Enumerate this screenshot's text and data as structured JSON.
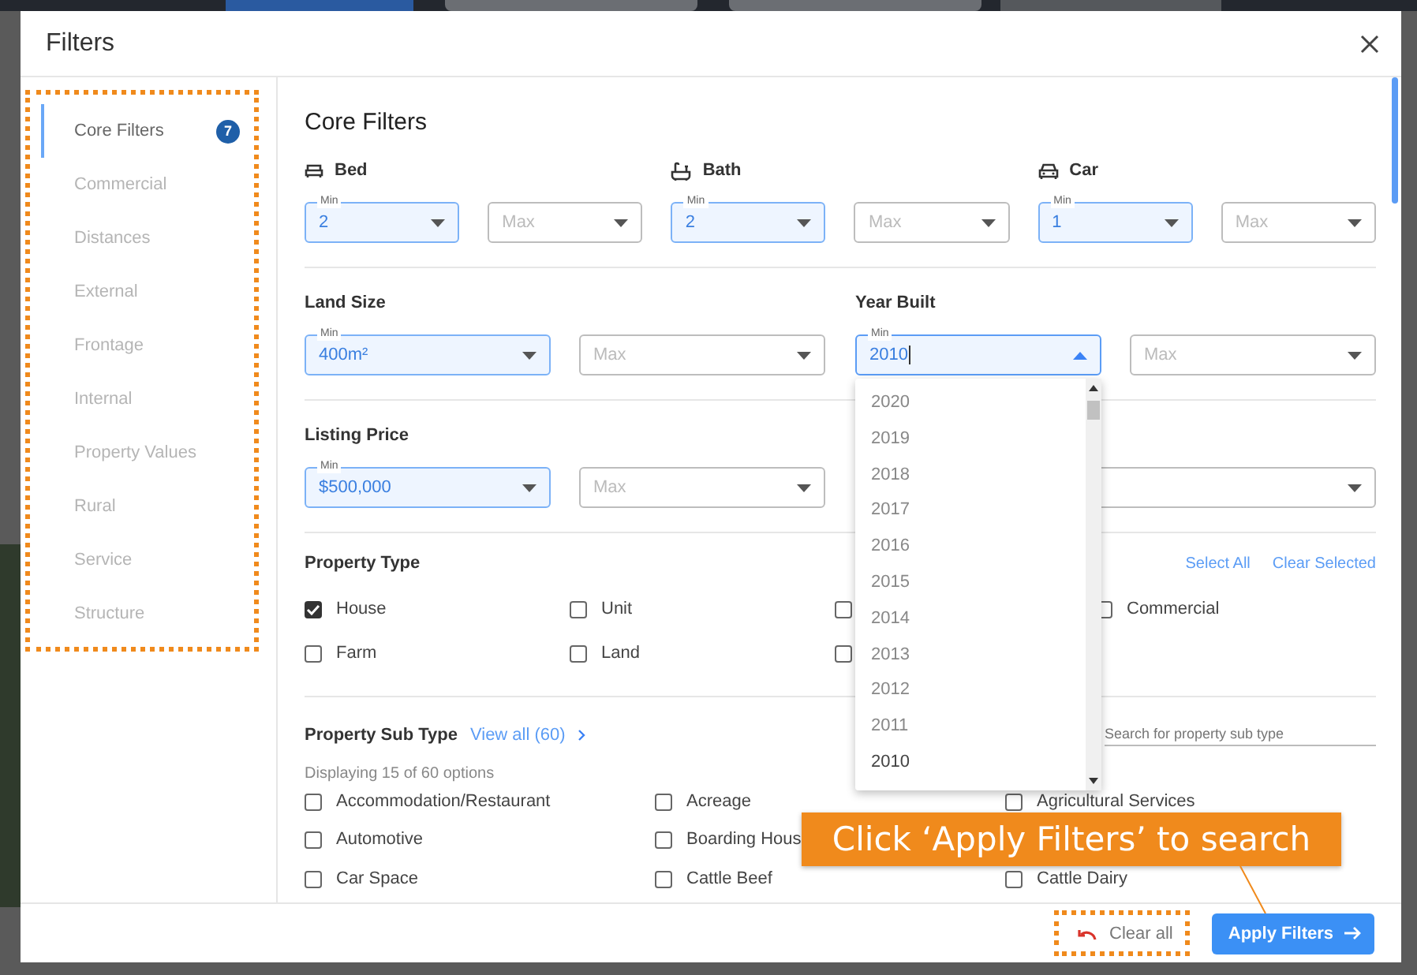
{
  "dialog": {
    "title": "Filters"
  },
  "sidebar": {
    "items": [
      {
        "label": "Core Filters",
        "selected": true,
        "badge": "7"
      },
      {
        "label": "Commercial",
        "selected": false
      },
      {
        "label": "Distances",
        "selected": false
      },
      {
        "label": "External",
        "selected": false
      },
      {
        "label": "Frontage",
        "selected": false
      },
      {
        "label": "Internal",
        "selected": false
      },
      {
        "label": "Property Values",
        "selected": false
      },
      {
        "label": "Rural",
        "selected": false
      },
      {
        "label": "Service",
        "selected": false
      },
      {
        "label": "Structure",
        "selected": false
      }
    ]
  },
  "section_title": "Core Filters",
  "field_rows": [
    {
      "groups": [
        {
          "label": "Bed",
          "kind": "bed",
          "selects": [
            {
              "label": "Min",
              "value": "2"
            },
            {
              "placeholder": "Max"
            }
          ]
        },
        {
          "label": "Bath",
          "kind": "bath",
          "selects": [
            {
              "label": "Min",
              "value": "2"
            },
            {
              "placeholder": "Max"
            }
          ]
        },
        {
          "label": "Car",
          "kind": "car",
          "selects": [
            {
              "label": "Min",
              "value": "1"
            },
            {
              "placeholder": "Max"
            }
          ]
        }
      ]
    },
    {
      "groups": [
        {
          "label": "Land Size",
          "kind": "range",
          "selects": [
            {
              "label": "Min",
              "value": "400m²"
            },
            {
              "placeholder": "Max"
            }
          ]
        },
        {
          "label": "Year Built",
          "kind": "range",
          "selects": [
            {
              "label": "Min",
              "value": "2010",
              "open": true,
              "options": [
                {
                  "label": "2020",
                  "selected": false
                },
                {
                  "label": "2019",
                  "selected": false
                },
                {
                  "label": "2018",
                  "selected": false
                },
                {
                  "label": "2017",
                  "selected": false
                },
                {
                  "label": "2016",
                  "selected": false
                },
                {
                  "label": "2015",
                  "selected": false
                },
                {
                  "label": "2014",
                  "selected": false
                },
                {
                  "label": "2013",
                  "selected": false
                },
                {
                  "label": "2012",
                  "selected": false
                },
                {
                  "label": "2011",
                  "selected": false
                },
                {
                  "label": "2010",
                  "selected": true
                }
              ]
            },
            {
              "placeholder": "Max"
            }
          ]
        }
      ]
    },
    {
      "groups": [
        {
          "label": "Listing Price",
          "kind": "range",
          "selects": [
            {
              "label": "Min",
              "value": "$500,000"
            },
            {
              "placeholder": "Max"
            }
          ]
        },
        {
          "kind": "select"
        }
      ]
    }
  ],
  "property_type": {
    "title": "Property Type",
    "actions": [
      "Select All",
      "Clear Selected"
    ],
    "options": [
      {
        "label": "House",
        "checked": true
      },
      {
        "label": "Unit",
        "checked": false
      },
      {
        "checked": false
      },
      {
        "label": "Commercial",
        "checked": false
      },
      {
        "label": "Farm",
        "checked": false
      },
      {
        "label": "Land",
        "checked": false
      },
      {
        "checked": false
      }
    ]
  },
  "property_sub_type": {
    "title": "Property Sub Type",
    "view_all": "View all (60)",
    "search_placeholder": "Search for property sub type",
    "count_text": "Displaying 15 of 60 options",
    "option_rows": [
      [
        {
          "label": "Accommodation/Restaurant",
          "checked": false
        },
        {
          "label": "Acreage",
          "checked": false
        },
        {
          "label": "Agricultural Services",
          "checked": false
        }
      ],
      [
        {
          "label": "Automotive",
          "checked": false
        },
        {
          "label": "Boarding Hous",
          "checked": false
        }
      ],
      [
        {
          "label": "Car Space",
          "checked": false
        },
        {
          "label": "Cattle Beef",
          "checked": false
        },
        {
          "label": "Cattle Dairy",
          "checked": false
        }
      ]
    ]
  },
  "footer": {
    "clear_button": "Clear all",
    "apply_button": "Apply Filters"
  },
  "callout": {
    "text": "Click ‘Apply Filters’ to search"
  }
}
